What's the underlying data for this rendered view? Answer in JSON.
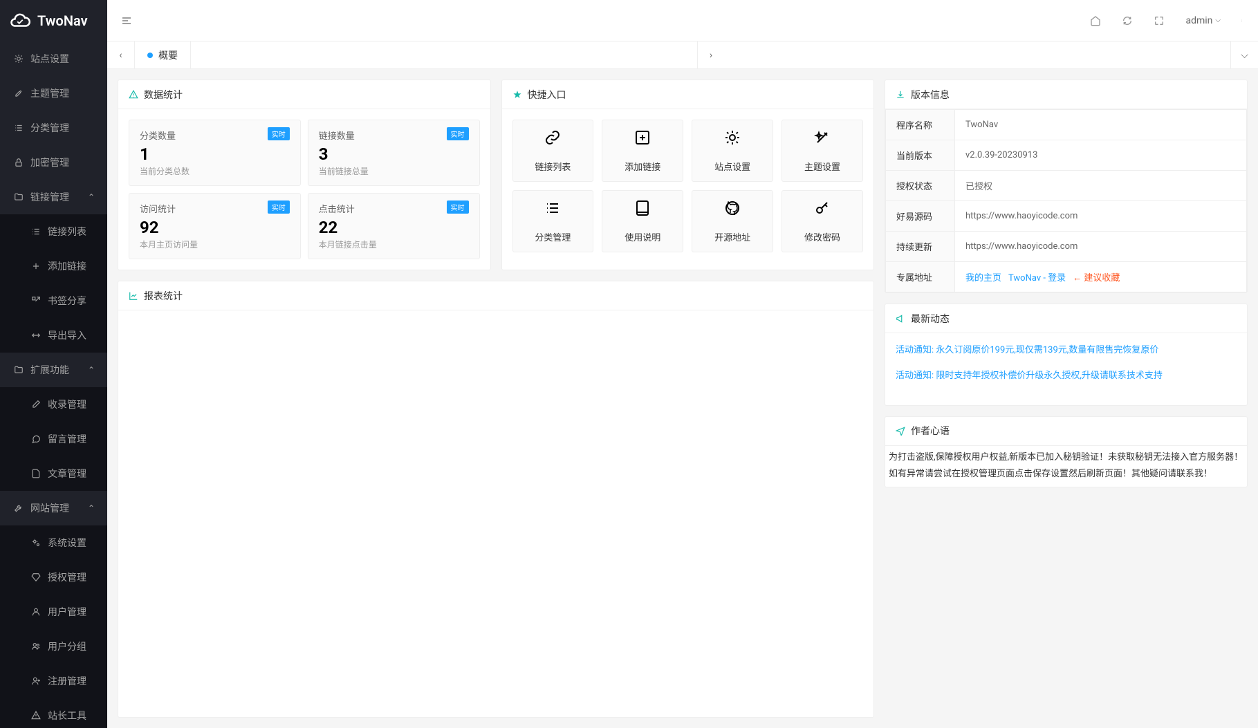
{
  "brand": "TwoNav",
  "topbar": {
    "user": "admin"
  },
  "tab": {
    "label": "概要"
  },
  "sidebar": {
    "items": [
      {
        "icon": "gear",
        "label": "站点设置"
      },
      {
        "icon": "brush",
        "label": "主题管理"
      },
      {
        "icon": "list",
        "label": "分类管理"
      },
      {
        "icon": "lock",
        "label": "加密管理"
      },
      {
        "icon": "folder",
        "label": "链接管理",
        "expanded": true,
        "children": [
          {
            "icon": "list",
            "label": "链接列表"
          },
          {
            "icon": "plus",
            "label": "添加链接"
          },
          {
            "icon": "share",
            "label": "书签分享"
          },
          {
            "icon": "transfer",
            "label": "导出导入"
          }
        ]
      },
      {
        "icon": "folder",
        "label": "扩展功能",
        "expanded": true,
        "children": [
          {
            "icon": "pencil",
            "label": "收录管理"
          },
          {
            "icon": "comment",
            "label": "留言管理"
          },
          {
            "icon": "doc",
            "label": "文章管理"
          }
        ]
      },
      {
        "icon": "wrench",
        "label": "网站管理",
        "expanded": true,
        "children": [
          {
            "icon": "gears",
            "label": "系统设置"
          },
          {
            "icon": "diamond",
            "label": "授权管理"
          },
          {
            "icon": "user",
            "label": "用户管理"
          },
          {
            "icon": "users",
            "label": "用户分组"
          },
          {
            "icon": "userplus",
            "label": "注册管理"
          },
          {
            "icon": "alert",
            "label": "站长工具"
          }
        ]
      }
    ]
  },
  "stats": {
    "header": "数据统计",
    "items": [
      {
        "title": "分类数量",
        "value": "1",
        "desc": "当前分类总数",
        "badge": "实时"
      },
      {
        "title": "链接数量",
        "value": "3",
        "desc": "当前链接总量",
        "badge": "实时"
      },
      {
        "title": "访问统计",
        "value": "92",
        "desc": "本月主页访问量",
        "badge": "实时"
      },
      {
        "title": "点击统计",
        "value": "22",
        "desc": "本月链接点击量",
        "badge": "实时"
      }
    ]
  },
  "quick": {
    "header": "快捷入口",
    "items": [
      {
        "icon": "link",
        "label": "链接列表"
      },
      {
        "icon": "plus-square",
        "label": "添加链接"
      },
      {
        "icon": "gear",
        "label": "站点设置"
      },
      {
        "icon": "magic",
        "label": "主题设置"
      },
      {
        "icon": "list",
        "label": "分类管理"
      },
      {
        "icon": "book",
        "label": "使用说明"
      },
      {
        "icon": "github",
        "label": "开源地址"
      },
      {
        "icon": "key",
        "label": "修改密码"
      }
    ]
  },
  "chart": {
    "header": "报表统计"
  },
  "version": {
    "header": "版本信息",
    "rows": [
      {
        "k": "程序名称",
        "v": "TwoNav"
      },
      {
        "k": "当前版本",
        "v": "v2.0.39-20230913"
      },
      {
        "k": "授权状态",
        "v": "已授权"
      },
      {
        "k": "好易源码",
        "v": "https://www.haoyicode.com"
      },
      {
        "k": "持续更新",
        "v": "https://www.haoyicode.com"
      },
      {
        "k": "专属地址",
        "links": [
          "我的主页",
          "TwoNav - 登录"
        ],
        "warn": "建议收藏"
      }
    ]
  },
  "news": {
    "header": "最新动态",
    "items": [
      "活动通知: 永久订阅原价199元,现仅需139元,数量有限售完恢复原价",
      "活动通知: 限时支持年授权补偿价升级永久授权,升级请联系技术支持"
    ]
  },
  "author": {
    "header": "作者心语",
    "lines": [
      "为打击盗版,保障授权用户权益,新版本已加入秘钥验证！未获取秘钥无法接入官方服务器！",
      "如有异常请尝试在授权管理页面点击保存设置然后刷新页面！其他疑问请联系我！"
    ]
  }
}
